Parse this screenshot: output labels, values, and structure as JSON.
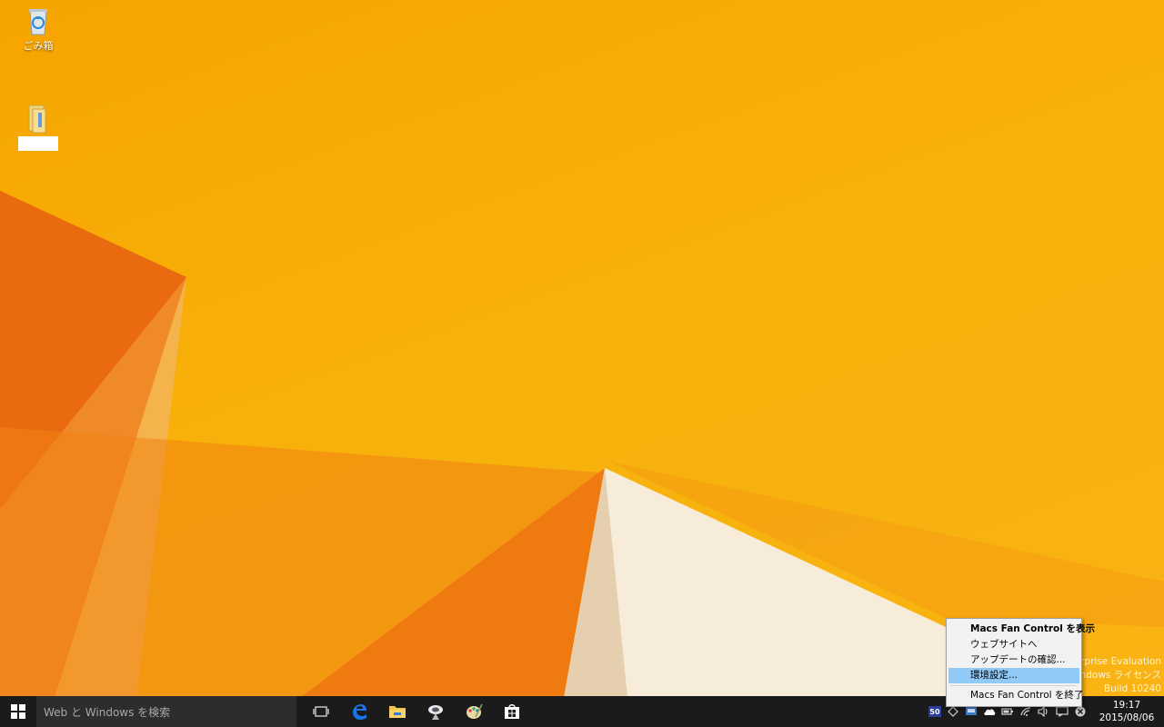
{
  "desktop": {
    "icons": [
      {
        "label": "ごみ箱"
      },
      {
        "label": ""
      }
    ]
  },
  "watermark": {
    "line1": "nterprise Evaluation",
    "line2": "Windows ライセンス",
    "line3": "Build 10240"
  },
  "context_menu": {
    "items": [
      {
        "label": "Macs Fan Control を表示"
      },
      {
        "label": "ウェブサイトへ"
      },
      {
        "label": "アップデートの確認..."
      },
      {
        "label": "環境設定..."
      },
      {
        "label": "Macs Fan Control を終了"
      }
    ]
  },
  "taskbar": {
    "search_placeholder": "Web と Windows を検索",
    "buttons": [
      {
        "icon": "task-view-icon"
      },
      {
        "icon": "edge-icon"
      },
      {
        "icon": "file-explorer-icon"
      },
      {
        "icon": "app-icon"
      },
      {
        "icon": "paint-icon"
      },
      {
        "icon": "store-icon"
      }
    ],
    "tray": {
      "fan_badge": "50",
      "clock_time": "19:17",
      "clock_date": "2015/08/06"
    }
  },
  "colors": {
    "wallpaper": "#f6a400",
    "taskbar": "#1b1b1b",
    "menu_highlight": "#91c9f7",
    "edge_blue": "#1a73e8"
  }
}
